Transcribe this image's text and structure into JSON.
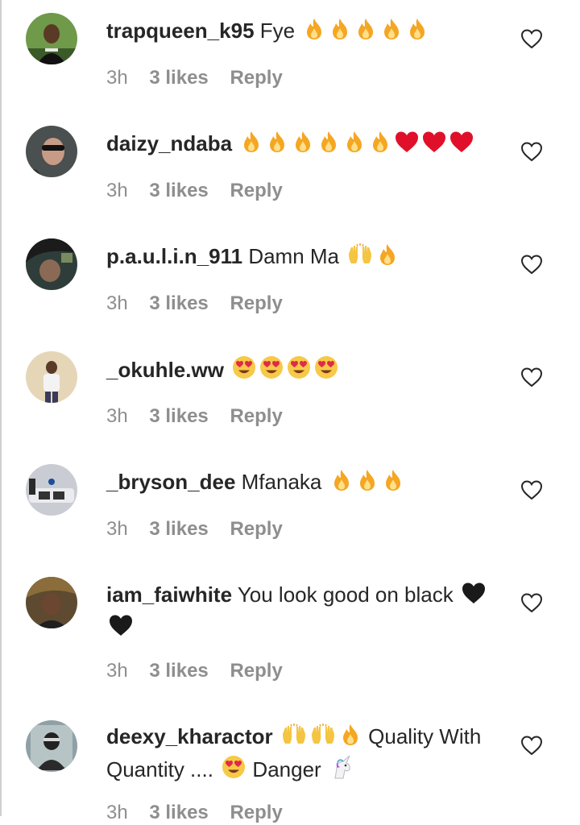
{
  "colors": {
    "text": "#262626",
    "meta": "#8e8e8e",
    "fire": "#f5a623",
    "red_heart": "#e0102a",
    "black_heart": "#1a1a1a"
  },
  "comments": [
    {
      "username": "trapqueen_k95",
      "text": "Fye",
      "emojis": [
        "fire",
        "fire",
        "fire",
        "fire",
        "fire"
      ],
      "time": "3h",
      "likes": "3 likes",
      "reply": "Reply"
    },
    {
      "username": "daizy_ndaba",
      "text": "",
      "emojis": [
        "fire",
        "fire",
        "fire",
        "fire",
        "fire",
        "fire",
        "red-heart",
        "red-heart",
        "red-heart"
      ],
      "time": "3h",
      "likes": "3 likes",
      "reply": "Reply"
    },
    {
      "username": "p.a.u.l.i.n_911",
      "text": "Damn Ma",
      "emojis": [
        "raising-hands",
        "fire"
      ],
      "time": "3h",
      "likes": "3 likes",
      "reply": "Reply"
    },
    {
      "username": "_okuhle.ww",
      "text": "",
      "emojis": [
        "heart-eyes",
        "heart-eyes",
        "heart-eyes",
        "heart-eyes"
      ],
      "time": "3h",
      "likes": "3 likes",
      "reply": "Reply"
    },
    {
      "username": "_bryson_dee",
      "text": "Mfanaka",
      "emojis": [
        "fire",
        "fire",
        "fire"
      ],
      "time": "3h",
      "likes": "3 likes",
      "reply": "Reply"
    },
    {
      "username": "iam_faiwhite",
      "text": "You look good on black",
      "emojis": [
        "black-heart",
        "black-heart"
      ],
      "time": "3h",
      "likes": "3 likes",
      "reply": "Reply"
    },
    {
      "username": "deexy_kharactor",
      "text_parts": [
        "Quality With Quantity ....",
        "Danger"
      ],
      "emojis_a": [
        "raising-hands",
        "raising-hands",
        "fire"
      ],
      "emojis_b": [
        "heart-eyes"
      ],
      "emojis_c": [
        "unicorn"
      ],
      "time": "3h",
      "likes": "3 likes",
      "reply": "Reply"
    }
  ]
}
